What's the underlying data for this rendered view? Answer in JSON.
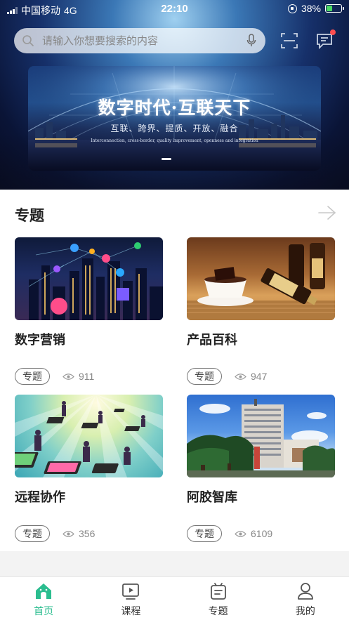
{
  "status_bar": {
    "carrier": "中国移动",
    "network": "4G",
    "time": "22:10",
    "battery": "38%"
  },
  "search": {
    "placeholder": "请输入你想要搜索的内容"
  },
  "banner": {
    "title": "数字时代·互联天下",
    "subtitle": "互联、跨界、提质、开放、融合",
    "english": "Interconnection, cross-border, quality improvement, openness and integration"
  },
  "section": {
    "title": "专题"
  },
  "cards": [
    {
      "title": "数字营销",
      "tag": "专题",
      "views": "911"
    },
    {
      "title": "产品百科",
      "tag": "专题",
      "views": "947"
    },
    {
      "title": "远程协作",
      "tag": "专题",
      "views": "356"
    },
    {
      "title": "阿胶智库",
      "tag": "专题",
      "views": "6109"
    }
  ],
  "tabbar": {
    "items": [
      {
        "label": "首页",
        "icon": "home-icon",
        "active": true
      },
      {
        "label": "课程",
        "icon": "play-icon",
        "active": false
      },
      {
        "label": "专题",
        "icon": "topic-icon",
        "active": false
      },
      {
        "label": "我的",
        "icon": "user-icon",
        "active": false
      }
    ]
  },
  "colors": {
    "accent": "#2bbd8f",
    "badge": "#ff4d4f"
  }
}
